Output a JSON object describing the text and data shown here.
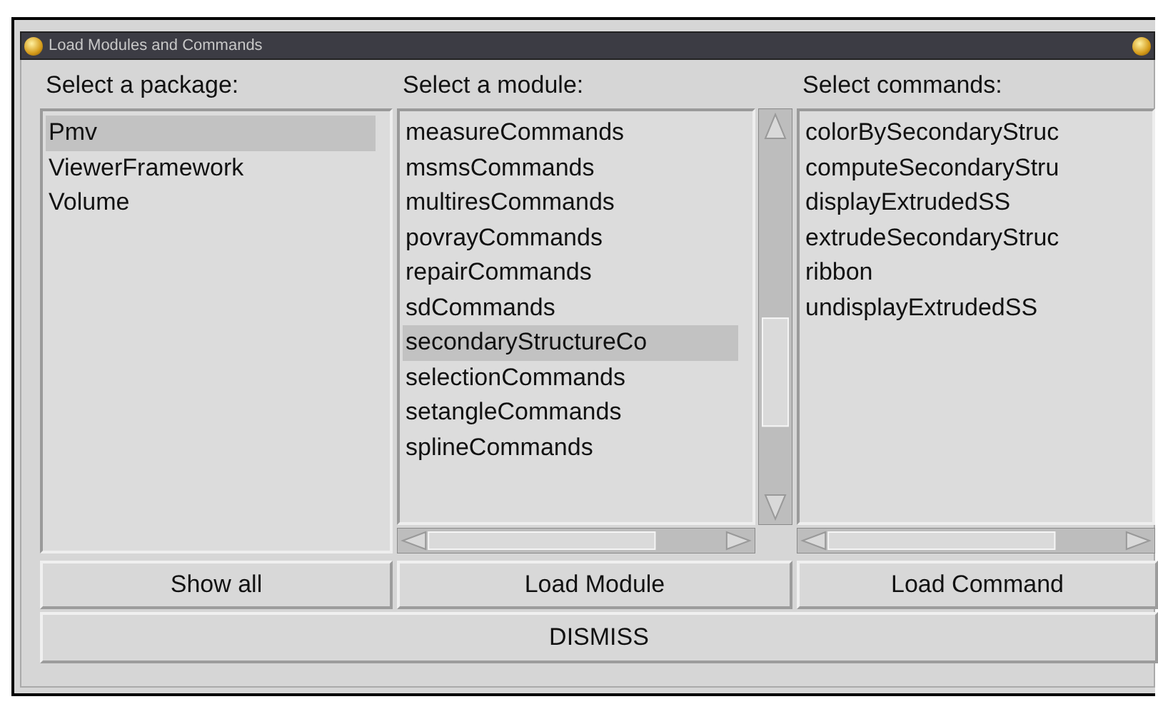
{
  "window": {
    "title": "Load Modules and Commands"
  },
  "columns": [
    {
      "header": "Select a package:",
      "items": [
        {
          "label": "Pmv",
          "selected": true
        },
        {
          "label": "ViewerFramework",
          "selected": false
        },
        {
          "label": "Volume",
          "selected": false
        }
      ]
    },
    {
      "header": "Select a module:",
      "scrollbars": true,
      "items": [
        {
          "label": "measureCommands",
          "selected": false
        },
        {
          "label": "msmsCommands",
          "selected": false
        },
        {
          "label": "multiresCommands",
          "selected": false
        },
        {
          "label": "povrayCommands",
          "selected": false
        },
        {
          "label": "repairCommands",
          "selected": false
        },
        {
          "label": "sdCommands",
          "selected": false
        },
        {
          "label": "secondaryStructureCo",
          "selected": true
        },
        {
          "label": "selectionCommands",
          "selected": false
        },
        {
          "label": "setangleCommands",
          "selected": false
        },
        {
          "label": "splineCommands",
          "selected": false
        }
      ]
    },
    {
      "header": "Select commands:",
      "scrollbars": true,
      "items": [
        {
          "label": "colorBySecondaryStruc",
          "selected": false
        },
        {
          "label": "computeSecondaryStru",
          "selected": false
        },
        {
          "label": "displayExtrudedSS",
          "selected": false
        },
        {
          "label": "extrudeSecondaryStruc",
          "selected": false
        },
        {
          "label": "ribbon",
          "selected": false
        },
        {
          "label": "undisplayExtrudedSS",
          "selected": false
        }
      ]
    }
  ],
  "buttons": [
    "Show all",
    "Load Module",
    "Load Command"
  ],
  "dismiss": "DISMISS"
}
